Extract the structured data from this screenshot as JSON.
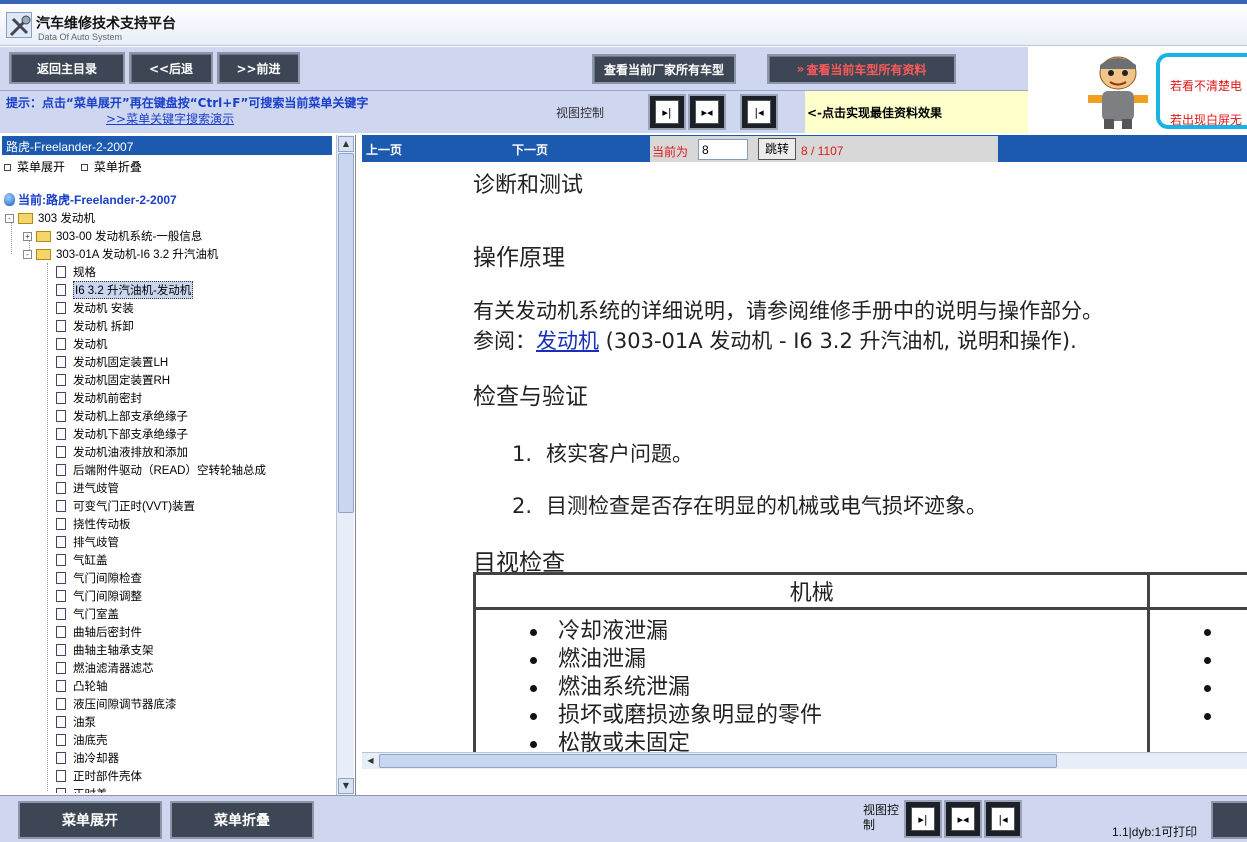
{
  "app": {
    "title": "汽车维修技术支持平台",
    "subtitle": "Data Of Auto System"
  },
  "toolbar": {
    "home": "返回主目录",
    "back": "<<后退",
    "forward": ">>前进",
    "maker_models": "查看当前厂家所有车型",
    "model_all": "查看当前车型所有资料"
  },
  "hint": {
    "text": "提示：点击“菜单展开”再在键盘按“Ctrl+F”可搜索当前菜单关键字",
    "link": ">>菜单关键字搜索演示",
    "view_control": "视图控制",
    "best_note": "<-点击实现最佳资料效果"
  },
  "ad": {
    "line1": "若看不清楚电",
    "line2": "若出现白屏无"
  },
  "sidebar": {
    "car_title": "路虎-Freelander-2-2007",
    "expand": "菜单展开",
    "collapse": "菜单折叠",
    "current": "当前:路虎-Freelander-2-2007",
    "tree": [
      {
        "label": "303 发动机",
        "kind": "folder",
        "level": 0,
        "toggle": "-"
      },
      {
        "label": "303-00 发动机系统-一般信息",
        "kind": "folder",
        "level": 1,
        "toggle": "+"
      },
      {
        "label": "303-01A 发动机-I6 3.2 升汽油机",
        "kind": "folder",
        "level": 1,
        "toggle": "-"
      },
      {
        "label": "规格",
        "kind": "doc",
        "level": 2
      },
      {
        "label": "I6 3.2 升汽油机-发动机",
        "kind": "doc",
        "level": 2,
        "selected": true
      },
      {
        "label": "发动机 安装",
        "kind": "doc",
        "level": 2
      },
      {
        "label": "发动机 拆卸",
        "kind": "doc",
        "level": 2
      },
      {
        "label": "发动机",
        "kind": "doc",
        "level": 2
      },
      {
        "label": "发动机固定装置LH",
        "kind": "doc",
        "level": 2
      },
      {
        "label": "发动机固定装置RH",
        "kind": "doc",
        "level": 2
      },
      {
        "label": "发动机前密封",
        "kind": "doc",
        "level": 2
      },
      {
        "label": "发动机上部支承绝缘子",
        "kind": "doc",
        "level": 2
      },
      {
        "label": "发动机下部支承绝缘子",
        "kind": "doc",
        "level": 2
      },
      {
        "label": "发动机油液排放和添加",
        "kind": "doc",
        "level": 2
      },
      {
        "label": "后端附件驱动（READ）空转轮轴总成",
        "kind": "doc",
        "level": 2
      },
      {
        "label": "进气歧管",
        "kind": "doc",
        "level": 2
      },
      {
        "label": "可变气门正时(VVT)装置",
        "kind": "doc",
        "level": 2
      },
      {
        "label": "挠性传动板",
        "kind": "doc",
        "level": 2
      },
      {
        "label": "排气歧管",
        "kind": "doc",
        "level": 2
      },
      {
        "label": "气缸盖",
        "kind": "doc",
        "level": 2
      },
      {
        "label": "气门间隙检查",
        "kind": "doc",
        "level": 2
      },
      {
        "label": "气门间隙调整",
        "kind": "doc",
        "level": 2
      },
      {
        "label": "气门室盖",
        "kind": "doc",
        "level": 2
      },
      {
        "label": "曲轴后密封件",
        "kind": "doc",
        "level": 2
      },
      {
        "label": "曲轴主轴承支架",
        "kind": "doc",
        "level": 2
      },
      {
        "label": "燃油滤清器滤芯",
        "kind": "doc",
        "level": 2
      },
      {
        "label": "凸轮轴",
        "kind": "doc",
        "level": 2
      },
      {
        "label": "液压间隙调节器底漆",
        "kind": "doc",
        "level": 2
      },
      {
        "label": "油泵",
        "kind": "doc",
        "level": 2
      },
      {
        "label": "油底壳",
        "kind": "doc",
        "level": 2
      },
      {
        "label": "油冷却器",
        "kind": "doc",
        "level": 2
      },
      {
        "label": "正时部件壳体",
        "kind": "doc",
        "level": 2
      },
      {
        "label": "正时盖",
        "kind": "doc",
        "level": 2
      }
    ]
  },
  "pager": {
    "prev": "上一页",
    "next": "下一页",
    "current_label": "当前为",
    "page_value": "8",
    "go": "跳转",
    "count": "8 / 1107"
  },
  "document": {
    "heading": "诊断和测试",
    "section1": "操作原理",
    "para1": "有关发动机系统的详细说明，请参阅维修手册中的说明与操作部分。",
    "ref_prefix": "参阅：",
    "ref_link": "发动机",
    "ref_suffix": " (303-01A 发动机 - I6 3.2 升汽油机, 说明和操作).",
    "section2": "检查与验证",
    "step1_num": "1.",
    "step1": "核实客户问题。",
    "step2_num": "2.",
    "step2": "目测检查是否存在明显的机械或电气损坏迹象。",
    "section3": "目视检查",
    "table_header": "机械",
    "mech_items": [
      "冷却液泄漏",
      "燃油泄漏",
      "燃油系统泄漏",
      "损坏或磨损迹象明显的零件",
      "松散或未固定"
    ]
  },
  "bottom": {
    "expand": "菜单展开",
    "collapse": "菜单折叠",
    "view_control": "视图控制",
    "version": "1.1|dyb:1可打印"
  },
  "colors": {
    "accent": "#1c5ab0",
    "toolbar_bg": "#cfd7f0",
    "button_bg": "#3d4654",
    "link": "#1a3fc8",
    "alert": "#e01818"
  }
}
